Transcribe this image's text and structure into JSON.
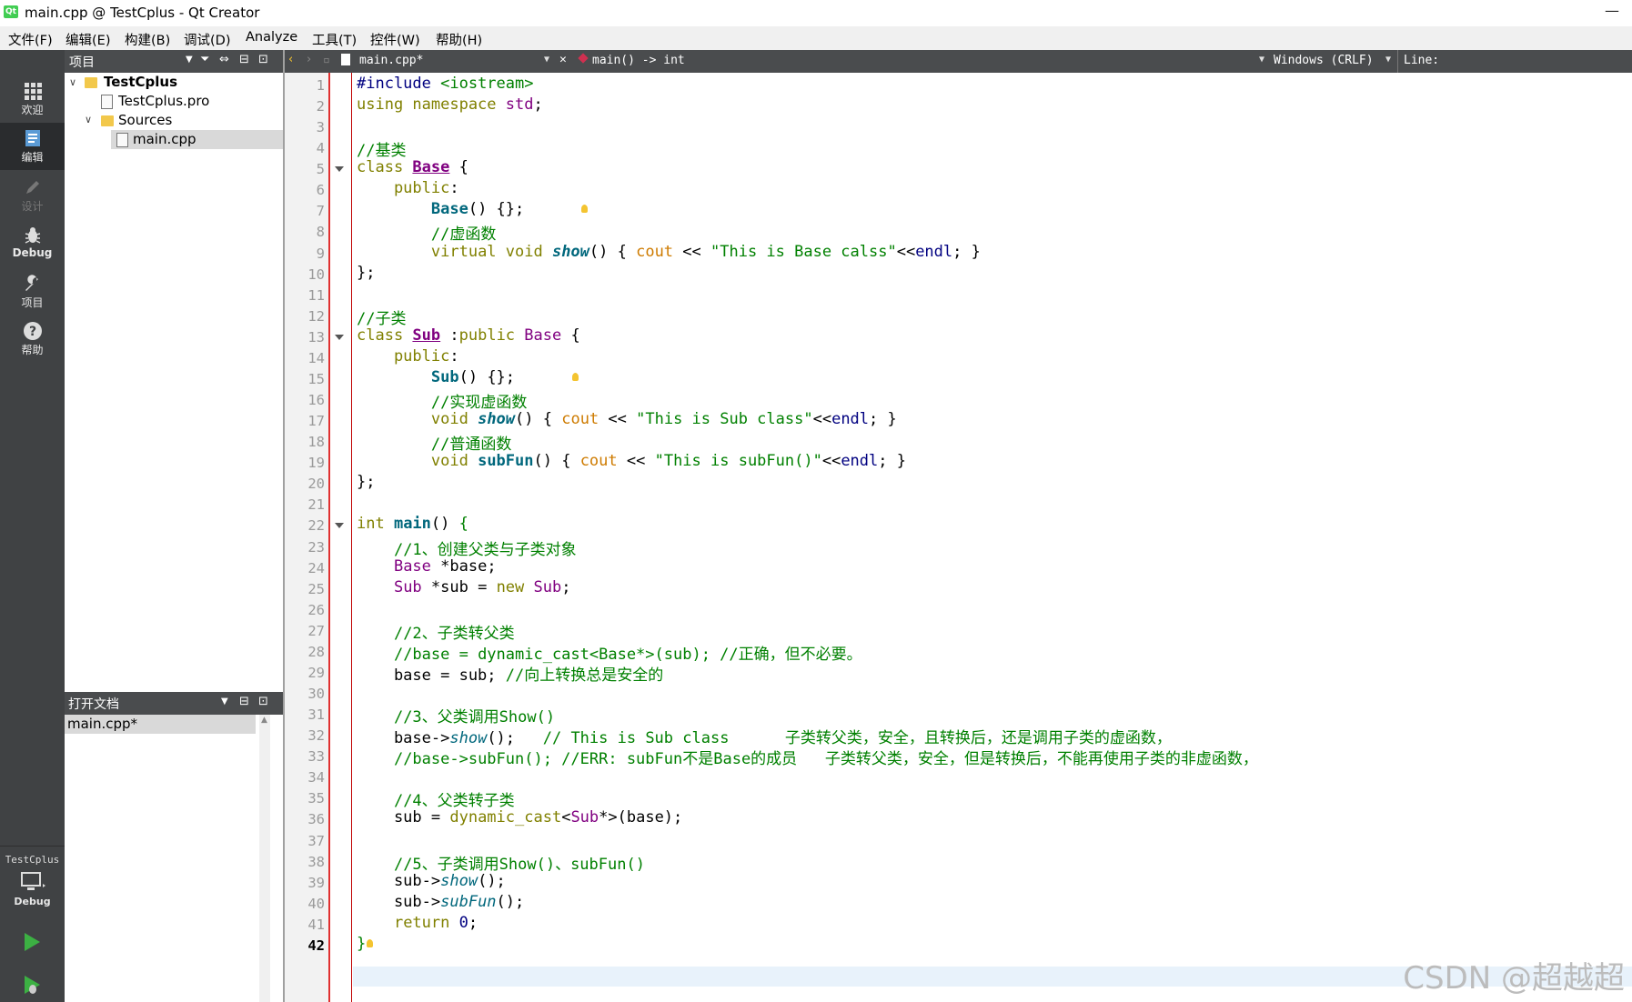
{
  "window": {
    "title": "main.cpp @ TestCplus - Qt Creator",
    "logo_text": "Qt",
    "minimize": "—"
  },
  "menu": [
    "文件(F)",
    "编辑(E)",
    "构建(B)",
    "调试(D)",
    "Analyze",
    "工具(T)",
    "控件(W)",
    "帮助(H)"
  ],
  "modes": [
    {
      "label": "欢迎",
      "icon": "grid-icon"
    },
    {
      "label": "编辑",
      "icon": "edit-doc-icon",
      "active": true
    },
    {
      "label": "设计",
      "icon": "pencil-icon",
      "disabled": true
    },
    {
      "label": "Debug",
      "icon": "bug-icon"
    },
    {
      "label": "项目",
      "icon": "wrench-icon"
    },
    {
      "label": "帮助",
      "icon": "help-icon"
    }
  ],
  "kit": {
    "project": "TestCplus",
    "config": "Debug"
  },
  "project_panel": {
    "title": "项目",
    "items": [
      {
        "label": "TestCplus",
        "bold": true
      },
      {
        "label": "TestCplus.pro"
      },
      {
        "label": "Sources"
      },
      {
        "label": "main.cpp",
        "selected": true
      }
    ]
  },
  "open_docs": {
    "title": "打开文档",
    "items": [
      "main.cpp*"
    ]
  },
  "editor_toolbar": {
    "file": "main.cpp*",
    "symbol": "main() -> int",
    "line_ending": "Windows (CRLF)",
    "position": "Line:"
  },
  "current_line": 42,
  "watermark": "CSDN @超越超",
  "code": [
    [
      [
        "ma",
        "#include "
      ],
      [
        "st",
        "<iostream>"
      ]
    ],
    [
      [
        "kw",
        "using namespace "
      ],
      [
        "ty",
        "std"
      ],
      [
        "",
        "; "
      ]
    ],
    [],
    [
      [
        "cm",
        "//基类"
      ]
    ],
    [
      [
        "kw",
        "class "
      ],
      [
        "cd",
        "Base"
      ],
      [
        "",
        " {"
      ]
    ],
    [
      [
        "kw",
        "    public"
      ],
      [
        "",
        ":"
      ]
    ],
    [
      [
        "",
        "        "
      ],
      [
        "fn",
        "Base"
      ],
      [
        "",
        "() {};"
      ]
    ],
    [
      [
        "",
        "        "
      ],
      [
        "cm",
        "//虚函数"
      ]
    ],
    [
      [
        "",
        "        "
      ],
      [
        "kw",
        "virtual void "
      ],
      [
        "fi",
        "show"
      ],
      [
        "",
        "() { "
      ],
      [
        "gl",
        "cout"
      ],
      [
        "",
        " << "
      ],
      [
        "st",
        "\"This is Base calss\""
      ],
      [
        "",
        "<<"
      ],
      [
        "cn",
        "endl"
      ],
      [
        "",
        "; }"
      ]
    ],
    [
      [
        "",
        "};"
      ]
    ],
    [],
    [
      [
        "cm",
        "//子类"
      ]
    ],
    [
      [
        "kw",
        "class "
      ],
      [
        "cd",
        "Sub"
      ],
      [
        "",
        " :"
      ],
      [
        "kw",
        "public "
      ],
      [
        "ty",
        "Base"
      ],
      [
        "",
        " {"
      ]
    ],
    [
      [
        "kw",
        "    public"
      ],
      [
        "",
        ":"
      ]
    ],
    [
      [
        "",
        "        "
      ],
      [
        "fn",
        "Sub"
      ],
      [
        "",
        "() {};"
      ]
    ],
    [
      [
        "",
        "        "
      ],
      [
        "cm",
        "//实现虚函数"
      ]
    ],
    [
      [
        "",
        "        "
      ],
      [
        "kw",
        "void "
      ],
      [
        "fi",
        "show"
      ],
      [
        "",
        "() { "
      ],
      [
        "gl",
        "cout"
      ],
      [
        "",
        " << "
      ],
      [
        "st",
        "\"This is Sub class\""
      ],
      [
        "",
        "<<"
      ],
      [
        "cn",
        "endl"
      ],
      [
        "",
        "; }"
      ]
    ],
    [
      [
        "",
        "        "
      ],
      [
        "cm",
        "//普通函数"
      ]
    ],
    [
      [
        "",
        "        "
      ],
      [
        "kw",
        "void "
      ],
      [
        "fn",
        "subFun"
      ],
      [
        "",
        "() { "
      ],
      [
        "gl",
        "cout"
      ],
      [
        "",
        " << "
      ],
      [
        "st",
        "\"This is subFun()\""
      ],
      [
        "",
        "<<"
      ],
      [
        "cn",
        "endl"
      ],
      [
        "",
        "; }"
      ]
    ],
    [
      [
        "",
        "};"
      ]
    ],
    [],
    [
      [
        "kw",
        "int "
      ],
      [
        "fn",
        "main"
      ],
      [
        "",
        "() "
      ],
      [
        "cm",
        "{"
      ]
    ],
    [
      [
        "",
        "    "
      ],
      [
        "cm",
        "//1、创建父类与子类对象"
      ]
    ],
    [
      [
        "",
        "    "
      ],
      [
        "ty",
        "Base"
      ],
      [
        "",
        " *base;"
      ]
    ],
    [
      [
        "",
        "    "
      ],
      [
        "ty",
        "Sub"
      ],
      [
        "",
        " *sub = "
      ],
      [
        "kw",
        "new "
      ],
      [
        "ty",
        "Sub"
      ],
      [
        "",
        ";"
      ]
    ],
    [],
    [
      [
        "",
        "    "
      ],
      [
        "cm",
        "//2、子类转父类"
      ]
    ],
    [
      [
        "",
        "    "
      ],
      [
        "cm",
        "//base = dynamic_cast<Base*>(sub); //正确，但不必要。"
      ]
    ],
    [
      [
        "",
        "    base = sub; "
      ],
      [
        "cm",
        "//向上转换总是安全的"
      ]
    ],
    [],
    [
      [
        "",
        "    "
      ],
      [
        "cm",
        "//3、父类调用Show()"
      ]
    ],
    [
      [
        "",
        "    base->"
      ],
      [
        "vi",
        "show"
      ],
      [
        "",
        "();   "
      ],
      [
        "cm",
        "// This is Sub class      子类转父类，安全，且转换后，还是调用子类的虚函数，"
      ]
    ],
    [
      [
        "",
        "    "
      ],
      [
        "cm",
        "//base->subFun(); //ERR: subFun不是Base的成员   子类转父类，安全，但是转换后，不能再使用子类的非虚函数，"
      ]
    ],
    [],
    [
      [
        "",
        "    "
      ],
      [
        "cm",
        "//4、父类转子类"
      ]
    ],
    [
      [
        "",
        "    sub = "
      ],
      [
        "kw",
        "dynamic_cast"
      ],
      [
        "",
        "<"
      ],
      [
        "ty",
        "Sub"
      ],
      [
        "",
        "*>(base);"
      ]
    ],
    [],
    [
      [
        "",
        "    "
      ],
      [
        "cm",
        "//5、子类调用Show()、subFun()"
      ]
    ],
    [
      [
        "",
        "    sub->"
      ],
      [
        "vi",
        "show"
      ],
      [
        "",
        "();"
      ]
    ],
    [
      [
        "",
        "    sub->"
      ],
      [
        "vi",
        "subFun"
      ],
      [
        "",
        "();"
      ]
    ],
    [
      [
        "",
        "    "
      ],
      [
        "kw",
        "return "
      ],
      [
        "cn",
        "0"
      ],
      [
        "",
        ";"
      ]
    ],
    [
      [
        "cm",
        "}"
      ]
    ]
  ]
}
